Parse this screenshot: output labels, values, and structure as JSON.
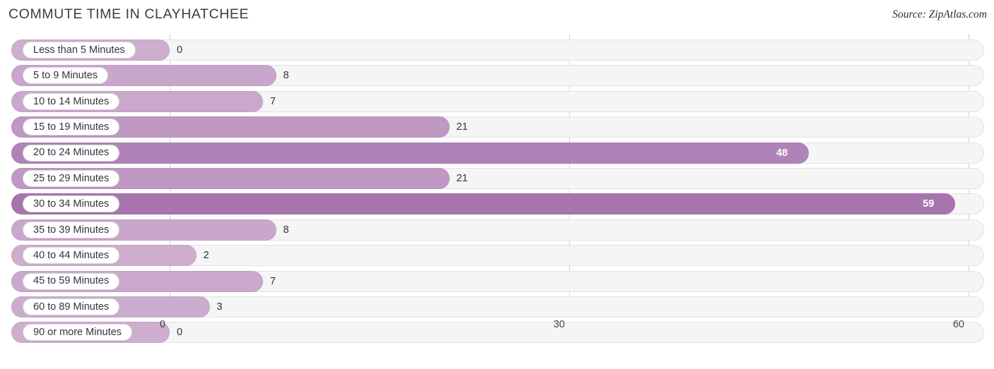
{
  "header": {
    "title": "COMMUTE TIME IN CLAYHATCHEE",
    "source": "Source: ZipAtlas.com"
  },
  "colors": {
    "bar_light": "#cdaecd",
    "bar_mid": "#c09ac4",
    "bar_dark": "#b083b8",
    "bar_darkest": "#a874ae",
    "track": "#f5f5f5",
    "gridline": "#d2d2d6",
    "title_text": "#3b3b46",
    "value_text": "#333338",
    "value_text_inside": "#ffffff"
  },
  "chart_data": {
    "type": "bar",
    "orientation": "horizontal",
    "title": "COMMUTE TIME IN CLAYHATCHEE",
    "xlabel": "",
    "ylabel": "",
    "xlim": [
      0,
      60
    ],
    "xticks": [
      0,
      30,
      60
    ],
    "xtick_labels": [
      "0",
      "30",
      "60"
    ],
    "grid": true,
    "legend": false,
    "categories": [
      "Less than 5 Minutes",
      "5 to 9 Minutes",
      "10 to 14 Minutes",
      "15 to 19 Minutes",
      "20 to 24 Minutes",
      "25 to 29 Minutes",
      "30 to 34 Minutes",
      "35 to 39 Minutes",
      "40 to 44 Minutes",
      "45 to 59 Minutes",
      "60 to 89 Minutes",
      "90 or more Minutes"
    ],
    "values": [
      0,
      8,
      7,
      21,
      48,
      21,
      59,
      8,
      2,
      7,
      3,
      0
    ],
    "value_labels": [
      "0",
      "8",
      "7",
      "21",
      "48",
      "21",
      "59",
      "8",
      "2",
      "7",
      "3",
      "0"
    ]
  },
  "rows": [
    {
      "label": "Less than 5 Minutes",
      "value": 0,
      "value_label": "0",
      "color": "#cdaecd",
      "inside": false
    },
    {
      "label": "5 to 9 Minutes",
      "value": 8,
      "value_label": "8",
      "color": "#c9a6cb",
      "inside": false
    },
    {
      "label": "10 to 14 Minutes",
      "value": 7,
      "value_label": "7",
      "color": "#caa8cc",
      "inside": false
    },
    {
      "label": "15 to 19 Minutes",
      "value": 21,
      "value_label": "21",
      "color": "#bf98c3",
      "inside": false
    },
    {
      "label": "20 to 24 Minutes",
      "value": 48,
      "value_label": "48",
      "color": "#b083b8",
      "inside": true
    },
    {
      "label": "25 to 29 Minutes",
      "value": 21,
      "value_label": "21",
      "color": "#bf98c3",
      "inside": false
    },
    {
      "label": "30 to 34 Minutes",
      "value": 59,
      "value_label": "59",
      "color": "#a874ae",
      "inside": true
    },
    {
      "label": "35 to 39 Minutes",
      "value": 8,
      "value_label": "8",
      "color": "#c9a6cb",
      "inside": false
    },
    {
      "label": "40 to 44 Minutes",
      "value": 2,
      "value_label": "2",
      "color": "#cdaecd",
      "inside": false
    },
    {
      "label": "45 to 59 Minutes",
      "value": 7,
      "value_label": "7",
      "color": "#caa8cc",
      "inside": false
    },
    {
      "label": "60 to 89 Minutes",
      "value": 3,
      "value_label": "3",
      "color": "#ccacce",
      "inside": false
    },
    {
      "label": "90 or more Minutes",
      "value": 0,
      "value_label": "0",
      "color": "#cdaecd",
      "inside": false
    }
  ]
}
